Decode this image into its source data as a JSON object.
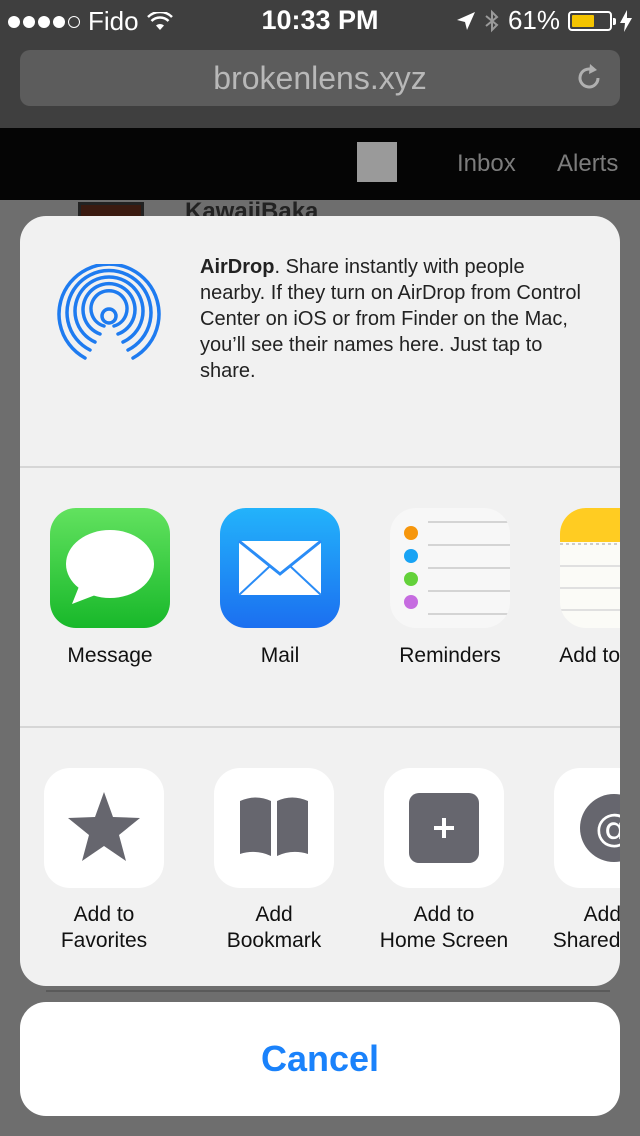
{
  "status_bar": {
    "carrier": "Fido",
    "time": "10:33 PM",
    "battery": "61%",
    "battery_level": 0.61
  },
  "browser": {
    "url": "brokenlens.xyz"
  },
  "site": {
    "nav": [
      "Inbox",
      "Alerts"
    ],
    "partial_name": "KawaiiBaka"
  },
  "share_sheet": {
    "airdrop": {
      "title": "AirDrop",
      "description": ". Share instantly with people nearby. If they turn on AirDrop from Control Center on iOS or from Finder on the Mac, you’ll see their names here. Just tap to share."
    },
    "apps": [
      {
        "label": "Message",
        "icon": "message-icon"
      },
      {
        "label": "Mail",
        "icon": "mail-icon"
      },
      {
        "label": "Reminders",
        "icon": "reminders-icon"
      },
      {
        "label": "Add to Notes",
        "icon": "notes-icon"
      }
    ],
    "actions": [
      {
        "line1": "Add to",
        "line2": "Favorites",
        "icon": "star-icon"
      },
      {
        "line1": "Add",
        "line2": "Bookmark",
        "icon": "book-icon"
      },
      {
        "line1": "Add to",
        "line2": "Home Screen",
        "icon": "plus-icon"
      },
      {
        "line1": "Add to",
        "line2": "Shared Links",
        "icon": "at-icon"
      }
    ],
    "cancel_label": "Cancel"
  },
  "colors": {
    "accent": "#1a82fb",
    "battery": "#f4c400"
  }
}
